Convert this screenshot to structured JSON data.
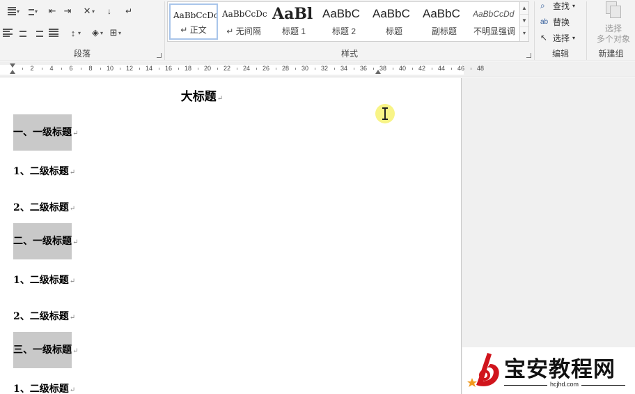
{
  "ribbon": {
    "paragraph_group": {
      "label": "段落"
    },
    "styles_group": {
      "label": "样式",
      "items": [
        {
          "preview": "AaBbCcDc",
          "name": "正文",
          "selected": true
        },
        {
          "preview": "AaBbCcDc",
          "name": "无间隔",
          "selected": false
        },
        {
          "preview": "AaBl",
          "name": "标题 1",
          "selected": false
        },
        {
          "preview": "AaBbC",
          "name": "标题 2",
          "selected": false
        },
        {
          "preview": "AaBbC",
          "name": "标题",
          "selected": false
        },
        {
          "preview": "AaBbC",
          "name": "副标题",
          "selected": false
        },
        {
          "preview": "AaBbCcDd",
          "name": "不明显强调",
          "selected": false
        }
      ]
    },
    "edit_group": {
      "label": "编辑",
      "find": "查找",
      "replace": "替换",
      "select": "选择"
    },
    "new_group": {
      "label": "新建组",
      "select_multiple_line1": "选择",
      "select_multiple_line2": "多个对象"
    }
  },
  "ruler": {
    "numbers": [
      "2",
      "4",
      "6",
      "8",
      "10",
      "12",
      "14",
      "16",
      "18",
      "20",
      "22",
      "24",
      "26",
      "28",
      "30",
      "32",
      "34",
      "36",
      "38",
      "40",
      "42",
      "44",
      "46",
      "48"
    ]
  },
  "document": {
    "title": "大标题",
    "paragraph_mark": "↵",
    "headings": [
      {
        "level": 1,
        "text": "一、一级标题"
      },
      {
        "level": 2,
        "text": "1、二级标题"
      },
      {
        "level": 2,
        "text": "2、二级标题"
      },
      {
        "level": 1,
        "text": "二、一级标题"
      },
      {
        "level": 2,
        "text": "1、二级标题"
      },
      {
        "level": 2,
        "text": "2、二级标题"
      },
      {
        "level": 1,
        "text": "三、一级标题"
      },
      {
        "level": 2,
        "text": "1、二级标题"
      }
    ]
  },
  "watermark": {
    "name": "宝安教程网",
    "url": "hcjhd.com"
  },
  "colors": {
    "ribbon_bg": "#f3f3f3",
    "heading_highlight": "#c9c9c9",
    "selected_style_border": "#a9c5ea",
    "cursor_halo": "#f7f37a",
    "logo_red": "#d0141c"
  }
}
